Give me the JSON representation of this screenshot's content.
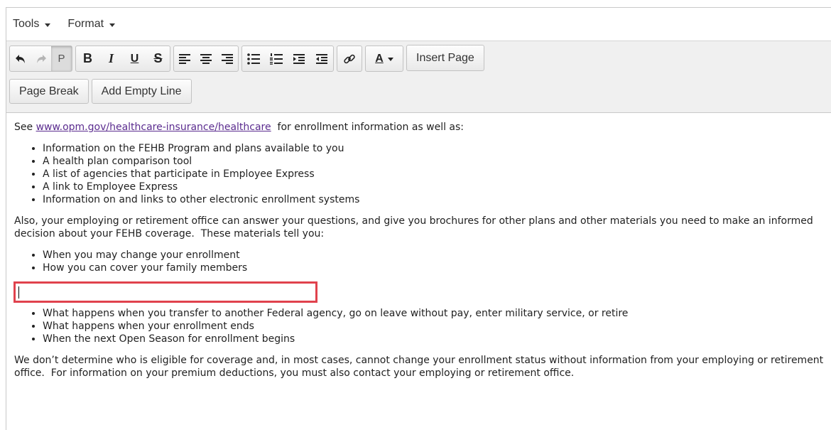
{
  "menubar": {
    "items": [
      {
        "label": "Tools"
      },
      {
        "label": "Format"
      }
    ]
  },
  "toolbar": {
    "paragraph_label": "P",
    "bold_label": "B",
    "italic_label": "I",
    "underline_label": "U",
    "strike_label": "S",
    "text_color_label": "A",
    "insert_page_label": "Insert Page",
    "page_break_label": "Page Break",
    "add_empty_line_label": "Add Empty Line"
  },
  "content": {
    "intro_prefix": "See ",
    "intro_link": "www.opm.gov/healthcare-insurance/healthcare",
    "intro_suffix": "  for enrollment information as well as:",
    "list1": [
      "Information on the FEHB Program and plans available to you",
      "A health plan comparison tool",
      "A list of agencies that participate in Employee Express",
      "A link to Employee Express",
      "Information on and links to other electronic enrollment systems"
    ],
    "para2": "Also, your employing or retirement office can answer your questions, and give you brochures for other plans and other materials you need to make an informed decision about your FEHB coverage.  These materials tell you:",
    "list2": [
      "When you may change your enrollment",
      "How you can cover your family members"
    ],
    "list3": [
      "What happens when you transfer to another Federal agency, go on leave without pay, enter military service, or retire",
      "What happens when your enrollment ends",
      "When the next Open Season for enrollment begins"
    ],
    "para3": "We don’t determine who is eligible for coverage and, in most cases, cannot change your enrollment status without information from your employing or retirement office.  For information on your premium deductions, you must also contact your employing or retirement office."
  },
  "colors": {
    "highlight_border": "#e0424d",
    "link": "#5b2c8f"
  }
}
